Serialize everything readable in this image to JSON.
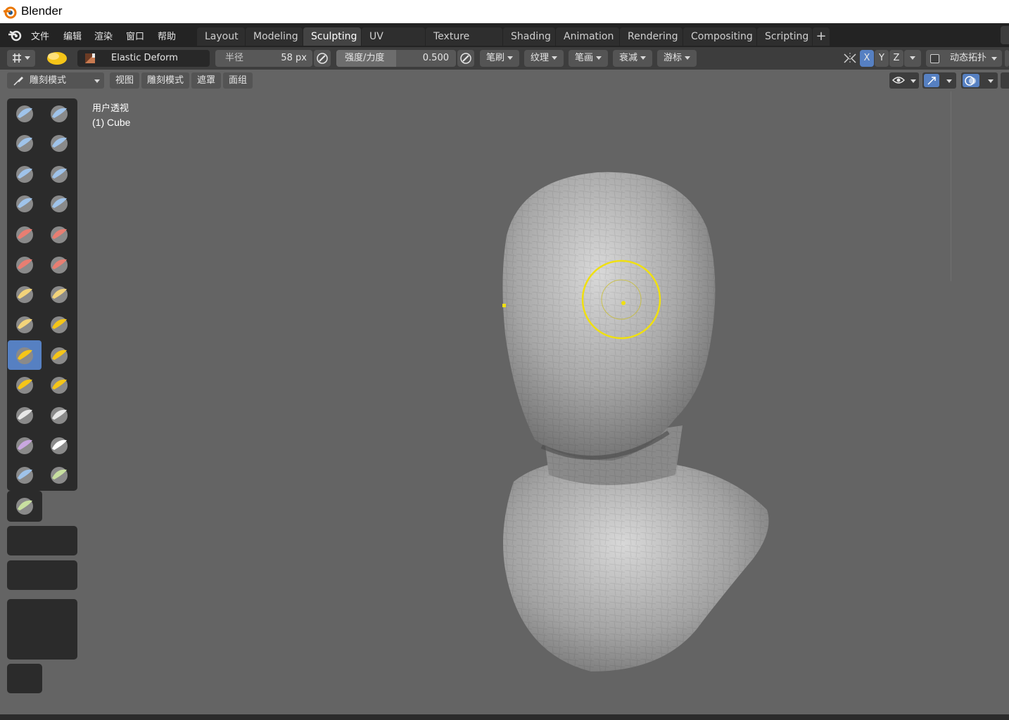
{
  "window": {
    "title": "Blender"
  },
  "menu": [
    "文件",
    "编辑",
    "渲染",
    "窗口",
    "帮助"
  ],
  "workspaces": [
    {
      "label": "Layout",
      "active": false
    },
    {
      "label": "Modeling",
      "active": false
    },
    {
      "label": "Sculpting",
      "active": true
    },
    {
      "label": "UV Editing",
      "active": false
    },
    {
      "label": "Texture Paint",
      "active": false
    },
    {
      "label": "Shading",
      "active": false
    },
    {
      "label": "Animation",
      "active": false
    },
    {
      "label": "Rendering",
      "active": false
    },
    {
      "label": "Compositing",
      "active": false
    },
    {
      "label": "Scripting",
      "active": false
    }
  ],
  "add_workspace": "+",
  "toolheader": {
    "brush_name": "Elastic Deform",
    "radius_label": "半径",
    "radius_value": "58 px",
    "strength_label": "强度/力度",
    "strength_value": "0.500",
    "dropdowns": [
      "笔刷",
      "纹理",
      "笔画",
      "衰减",
      "游标"
    ],
    "axis_x": "X",
    "axis_y": "Y",
    "axis_z": "Z",
    "dyntopo_label": "动态拓扑"
  },
  "viewport_header": {
    "mode": "雕刻模式",
    "menus": [
      "视图",
      "雕刻模式",
      "遮罩",
      "面组"
    ]
  },
  "viewport": {
    "perspective": "用户透视",
    "object": "(1) Cube"
  },
  "colors": {
    "accent": "#5680c2",
    "cursor": "#f0e010",
    "viewport_bg": "#646464"
  }
}
